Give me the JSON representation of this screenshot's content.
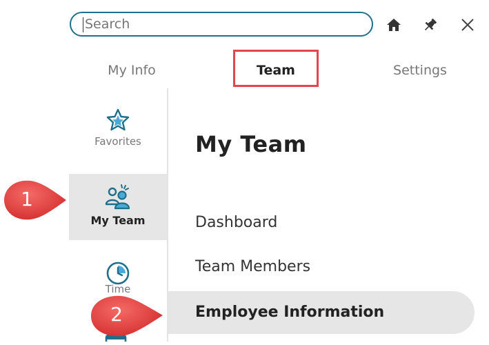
{
  "search": {
    "placeholder": "Search"
  },
  "toolbar": {
    "home_icon": "home-icon",
    "pin_icon": "pin-icon",
    "close_icon": "close-icon"
  },
  "tabs": [
    {
      "label": "My Info"
    },
    {
      "label": "Team",
      "active": true
    },
    {
      "label": "Settings"
    }
  ],
  "sidebar": {
    "items": [
      {
        "label": "Favorites",
        "icon": "star-icon"
      },
      {
        "label": "My Team",
        "icon": "team-icon",
        "selected": true
      },
      {
        "label": "Time",
        "icon": "clock-icon"
      }
    ]
  },
  "main": {
    "title": "My Team",
    "menu": [
      {
        "label": "Dashboard"
      },
      {
        "label": "Team Members"
      },
      {
        "label": "Employee Information",
        "selected": true
      }
    ]
  },
  "callouts": [
    {
      "number": "1"
    },
    {
      "number": "2"
    }
  ],
  "colors": {
    "accent": "#1f6f8b",
    "highlight_border": "#e0474c",
    "callout_fill": "#e8403f",
    "selected_bg": "#e6e6e6"
  }
}
